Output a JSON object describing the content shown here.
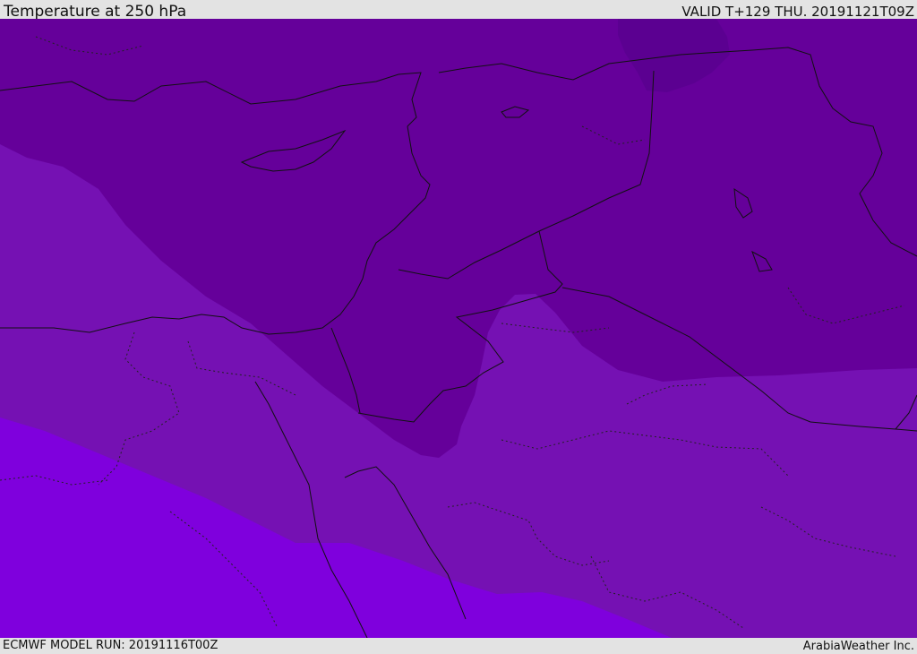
{
  "header": {
    "title": "Temperature at 250 hPa",
    "valid": "VALID T+129 THU. 20191121T09Z"
  },
  "footer": {
    "model_run": "ECMWF MODEL RUN: 20191116T00Z",
    "credit": "ArabiaWeather Inc."
  },
  "map": {
    "variable": "Temperature at 250 hPa",
    "colors": {
      "band_darkest": "#5b0091",
      "band_dark": "#65009a",
      "band_mid": "#7511b3",
      "band_bright": "#7f00dd",
      "coastline": "#111111",
      "borders": "#1a1a1a"
    }
  }
}
